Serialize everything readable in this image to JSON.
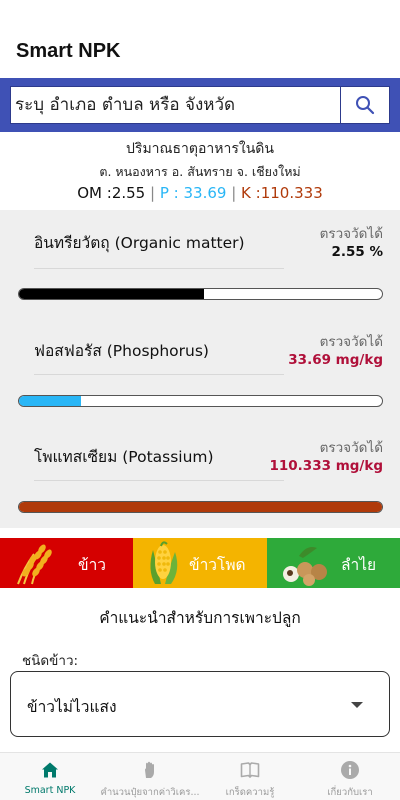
{
  "app": {
    "title": "Smart NPK"
  },
  "search": {
    "placeholder": "ระบุ อำเภอ ตำบล หรือ จังหวัด",
    "icon": "search-icon"
  },
  "summary": {
    "title": "ปริมาณธาตุอาหารในดิน",
    "location": "ต. หนองหาร อ. สันทราย จ. เชียงใหม่",
    "om_text": "OM :2.55",
    "sep": "|",
    "p_text": "P : 33.69",
    "k_text": "K :110.333"
  },
  "nutrients": [
    {
      "name": "อินทรียวัตถุ  (Organic matter)",
      "measured_label": "ตรวจวัดได้",
      "value_text": "2.55 %",
      "value_color": "#111111",
      "bar_color": "#000000",
      "level": 0.51
    },
    {
      "name": "ฟอสฟอรัส  (Phosphorus)",
      "measured_label": "ตรวจวัดได้",
      "value_text": "33.69 mg/kg",
      "value_color": "#b0103a",
      "bar_color": "#29b6f6",
      "level": 0.17
    },
    {
      "name": "โพแทสเซียม  (Potassium)",
      "measured_label": "ตรวจวัดได้",
      "value_text": "110.333 mg/kg",
      "value_color": "#b0103a",
      "bar_color": "#b03a0a",
      "level": 1.0
    }
  ],
  "crops": [
    {
      "label": "ข้าว",
      "color": "#d50000",
      "icon": "rice-icon"
    },
    {
      "label": "ข้าวโพด",
      "color": "#f4b400",
      "icon": "corn-icon"
    },
    {
      "label": "ลำไย",
      "color": "#2eaa3a",
      "icon": "longan-icon"
    }
  ],
  "recommendation": {
    "title": "คำแนะนำสำหรับการเพาะปลูก",
    "rice_type_label": "ชนิดข้าว:",
    "rice_type_value": "ข้าวไม่ไวแสง"
  },
  "nav": [
    {
      "label": "Smart NPK",
      "icon": "home-icon",
      "active": true
    },
    {
      "label": "คำนวนปุ๋ยจากค่าวิเคร...",
      "icon": "hand-icon",
      "active": false
    },
    {
      "label": "เกร็ดความรู้",
      "icon": "book-icon",
      "active": false
    },
    {
      "label": "เกี่ยวกับเรา",
      "icon": "info-icon",
      "active": false
    }
  ],
  "colors": {
    "accent": "#3f51b5",
    "nav_active": "#00796b",
    "panel_bg": "#efefef"
  }
}
